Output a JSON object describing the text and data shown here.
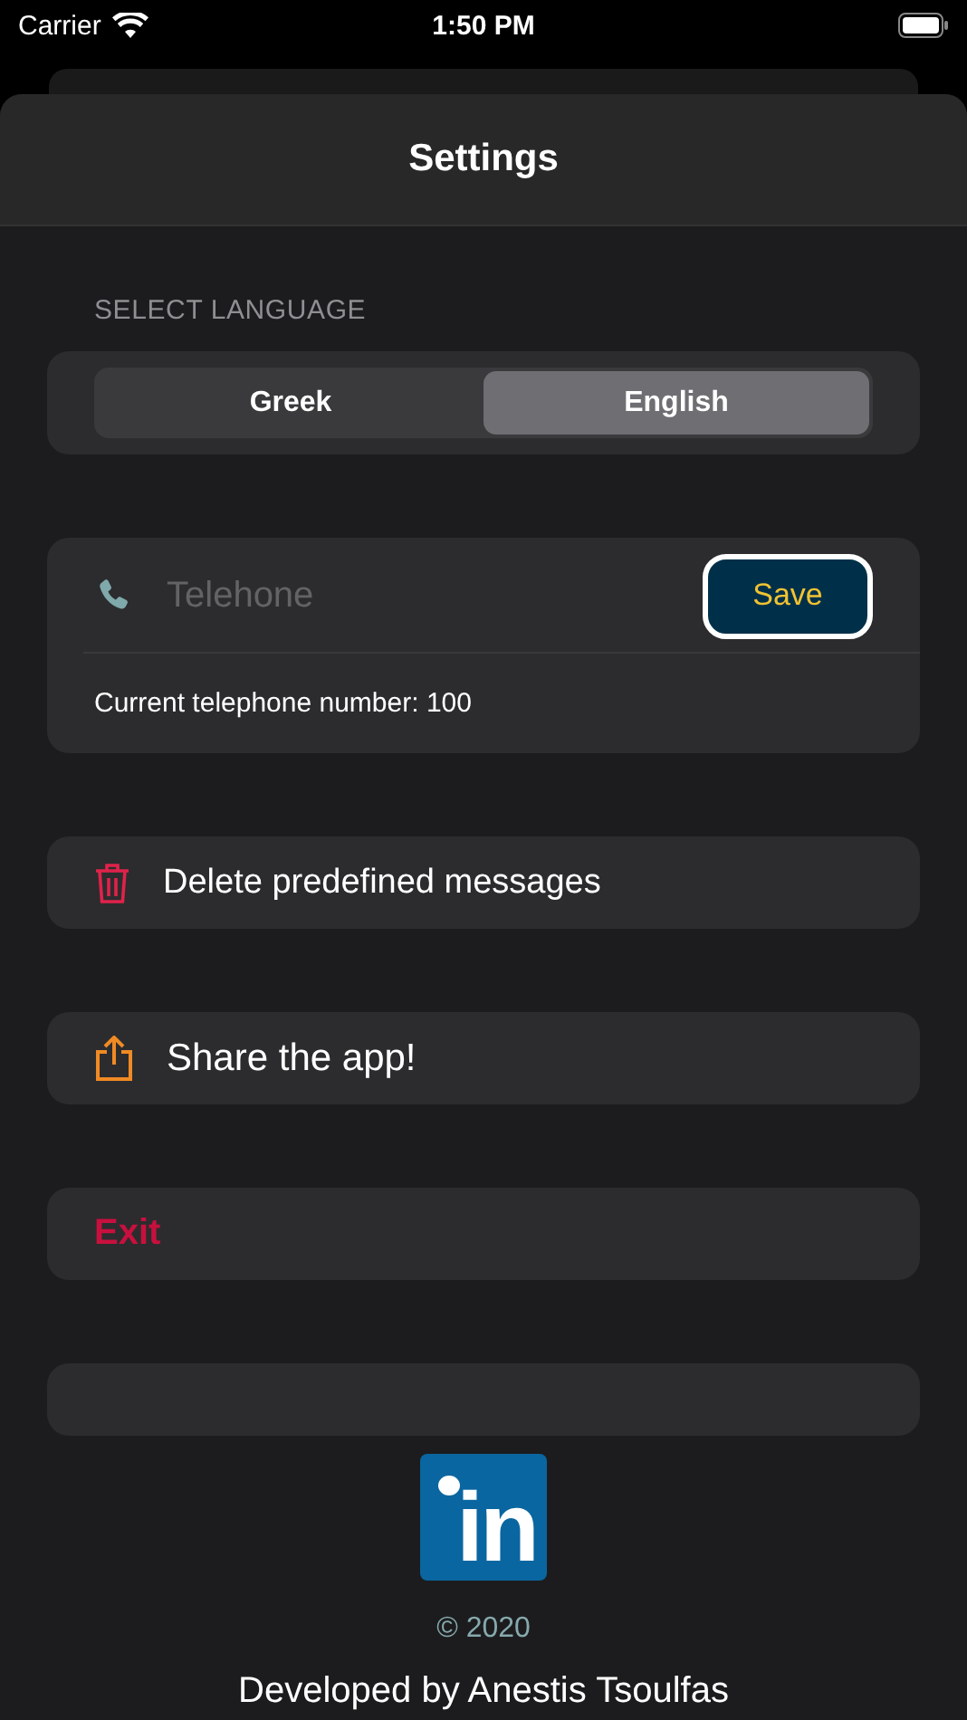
{
  "status_bar": {
    "carrier": "Carrier",
    "time": "1:50 PM"
  },
  "header": {
    "title": "Settings"
  },
  "language": {
    "label": "SELECT LANGUAGE",
    "options": [
      {
        "label": "Greek",
        "selected": false
      },
      {
        "label": "English",
        "selected": true
      }
    ]
  },
  "phone": {
    "placeholder": "Telehone",
    "save": "Save",
    "current": "Current telephone number: 100"
  },
  "actions": [
    {
      "kind": "delete",
      "label": "Delete predefined messages"
    },
    {
      "kind": "share",
      "label": "Share the app!"
    },
    {
      "kind": "exit",
      "label": "Exit"
    }
  ],
  "footer": {
    "logo_text": "in",
    "copyright": "© 2020",
    "developer": "Developed by Anestis Tsoulfas"
  }
}
